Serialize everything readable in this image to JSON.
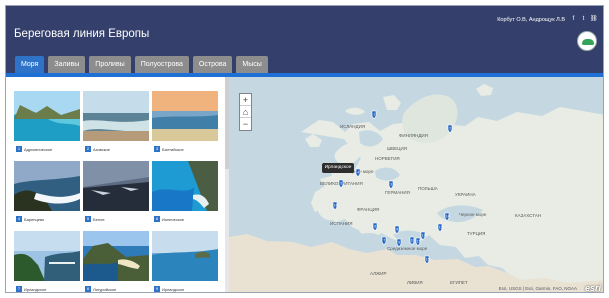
{
  "app": {
    "title": "Береговая линия Европы",
    "author": "Корбут О.В, Андрощук Л.В"
  },
  "tabs": [
    "Моря",
    "Заливы",
    "Проливы",
    "Полуострова",
    "Острова",
    "Мысы"
  ],
  "gallery": [
    {
      "num": "1",
      "label": "Адриатическое",
      "icon": "sea-photo"
    },
    {
      "num": "2",
      "label": "Азовское",
      "icon": "sea-photo"
    },
    {
      "num": "3",
      "label": "Балтийское",
      "icon": "sea-photo"
    },
    {
      "num": "4",
      "label": "Баренцево",
      "icon": "sea-photo"
    },
    {
      "num": "5",
      "label": "Белое",
      "icon": "sea-photo"
    },
    {
      "num": "6",
      "label": "Ионическое",
      "icon": "sea-photo"
    },
    {
      "num": "7",
      "label": "Ирландское",
      "icon": "sea-photo"
    },
    {
      "num": "8",
      "label": "Лигурийское",
      "icon": "sea-photo"
    },
    {
      "num": "9",
      "label": "Ирландское",
      "icon": "sea-photo"
    }
  ],
  "map": {
    "tooltip": "Ирландское",
    "labels": [
      "ИСЛАНДИЯ",
      "НОРВЕГИЯ",
      "ФИНЛЯНДИЯ",
      "ШВЕЦИЯ",
      "ВЕЛИКОБРИТАНИЯ",
      "ФРАНЦИЯ",
      "ИСПАНИЯ",
      "ГЕРМАНИЯ",
      "ПОЛЬША",
      "УКРАИНА",
      "КАЗАХСТАН",
      "АЛЖИР",
      "ЛИВИЯ",
      "ЕГИПЕТ",
      "ТУРЦИЯ",
      "Северное море",
      "Средиземное море",
      "Черное море"
    ],
    "markers": [
      "1",
      "2",
      "3",
      "4",
      "5",
      "6",
      "7",
      "8",
      "9",
      "10",
      "11",
      "12",
      "13",
      "14",
      "15",
      "16"
    ],
    "attribution": "Esri, USGS | Esri, Garmin, FAO, NOAA",
    "brand": "esri"
  },
  "colors": {
    "header": "#34406b",
    "active_tab": "#2f73c9",
    "tab": "#8d8d8d",
    "marker": "#2566c5"
  }
}
